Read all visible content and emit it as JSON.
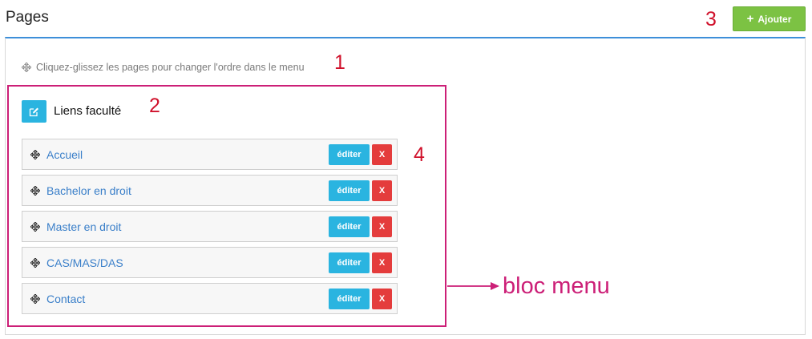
{
  "header": {
    "title": "Pages",
    "add_button_label": "Ajouter",
    "add_icon": "plus-icon"
  },
  "hint": {
    "text": "Cliquez-glissez les pages pour changer l'ordre dans le menu",
    "icon": "move-icon"
  },
  "menu": {
    "name": "Liens faculté",
    "edit_icon": "pencil-square-icon",
    "items": [
      {
        "label": "Accueil",
        "edit_label": "éditer",
        "delete_label": "X"
      },
      {
        "label": "Bachelor en droit",
        "edit_label": "éditer",
        "delete_label": "X"
      },
      {
        "label": "Master en droit",
        "edit_label": "éditer",
        "delete_label": "X"
      },
      {
        "label": "CAS/MAS/DAS",
        "edit_label": "éditer",
        "delete_label": "X"
      },
      {
        "label": "Contact",
        "edit_label": "éditer",
        "delete_label": "X"
      }
    ]
  },
  "annotations": {
    "n1": "1",
    "n2": "2",
    "n3": "3",
    "n4": "4",
    "bloc_label": "bloc menu"
  },
  "colors": {
    "accent_blue": "#3d8fd9",
    "add_green": "#7cc243",
    "edit_cyan": "#2ab4e0",
    "delete_red": "#e43c3c",
    "annotation_red": "#d0112b",
    "annotation_magenta": "#cc1f77",
    "link_blue": "#3a7fc9"
  }
}
